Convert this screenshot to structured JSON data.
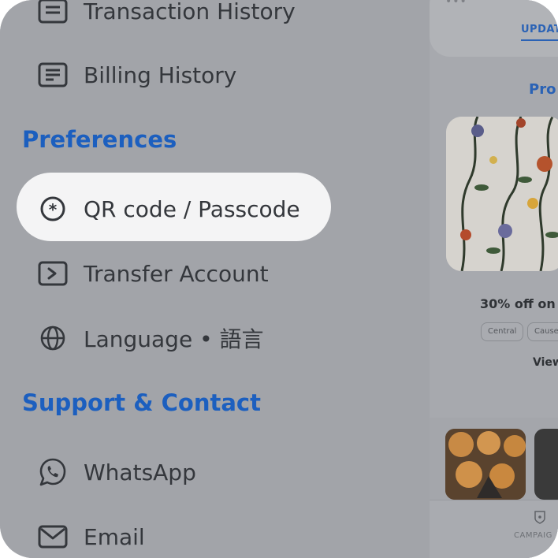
{
  "drawer": {
    "items_top": [
      {
        "label": "Transaction History",
        "icon": "receipt-icon"
      },
      {
        "label": "Billing History",
        "icon": "document-icon"
      }
    ],
    "preferences": {
      "title": "Preferences",
      "items": [
        {
          "label": "QR code / Passcode",
          "icon": "asterisk-icon",
          "selected": true
        },
        {
          "label": "Transfer Account",
          "icon": "transfer-icon"
        },
        {
          "label": "Language • 語言",
          "icon": "globe-icon"
        }
      ]
    },
    "support": {
      "title": "Support & Contact",
      "items": [
        {
          "label": "WhatsApp",
          "icon": "whatsapp-icon"
        },
        {
          "label": "Email",
          "icon": "mail-icon"
        }
      ]
    }
  },
  "background": {
    "tab_label": "UPDAT",
    "promo_title": "Pro",
    "offer_title": "30% off on",
    "chips": [
      "Central",
      "Causew"
    ],
    "view_label": "View",
    "nav_label": "CAMPAIG",
    "dots": "•••"
  },
  "colors": {
    "accent": "#1c5fbf",
    "overlay": "#a2a4a9",
    "highlight": "#f4f4f5",
    "text": "#34373c"
  }
}
